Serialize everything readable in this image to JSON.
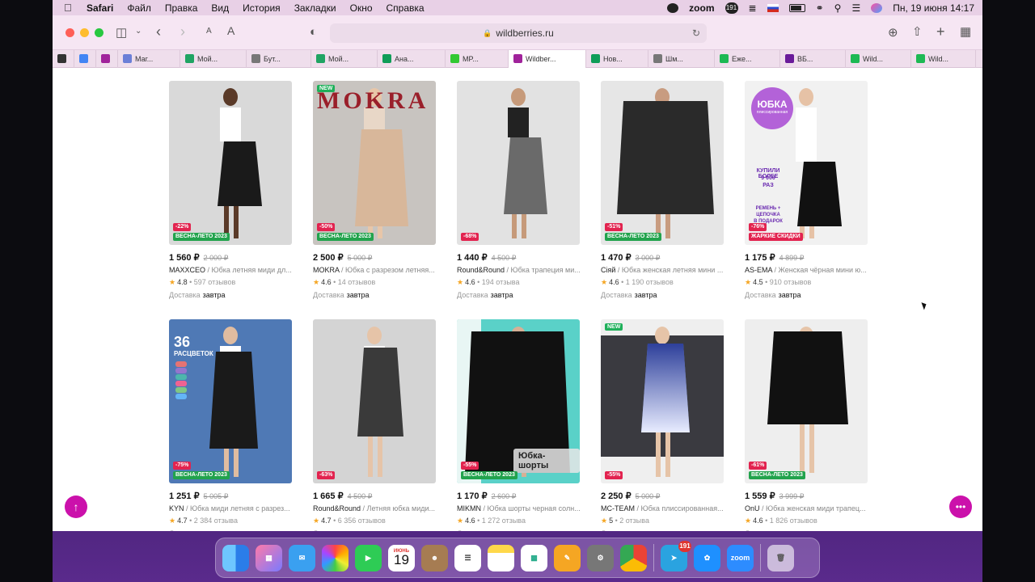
{
  "menubar": {
    "app": "Safari",
    "items": [
      "Файл",
      "Правка",
      "Вид",
      "История",
      "Закладки",
      "Окно",
      "Справка"
    ],
    "zoom": "zoom",
    "badge": "191",
    "datetime": "Пн, 19 июня  14:17"
  },
  "browser": {
    "url": "wildberries.ru",
    "tabs": [
      {
        "label": "",
        "icon": "extension-icon",
        "color": "#333333"
      },
      {
        "label": "",
        "icon": "calendar-icon",
        "color": "#4285f4"
      },
      {
        "label": "",
        "icon": "wb-icon",
        "color": "#a0239b"
      },
      {
        "label": "Маг...",
        "icon": "chart-icon",
        "color": "#6b7fd7"
      },
      {
        "label": "Мой...",
        "icon": "drive-icon",
        "color": "#1fa463"
      },
      {
        "label": "Бут...",
        "icon": "doc-icon",
        "color": "#777777"
      },
      {
        "label": "Мой...",
        "icon": "drive-icon",
        "color": "#1fa463"
      },
      {
        "label": "Ана...",
        "icon": "sheets-icon",
        "color": "#0f9d58"
      },
      {
        "label": "MP...",
        "icon": "mp-icon",
        "color": "#32c832"
      },
      {
        "label": "Wildber...",
        "icon": "wb-icon",
        "color": "#a0239b"
      },
      {
        "label": "Нов...",
        "icon": "sheets-icon",
        "color": "#0f9d58"
      },
      {
        "label": "Шм...",
        "icon": "doc-icon",
        "color": "#777777"
      },
      {
        "label": "Еже...",
        "icon": "v-icon",
        "color": "#1db954"
      },
      {
        "label": "ВБ...",
        "icon": "wb-icon",
        "color": "#6a1b9a"
      },
      {
        "label": "Wild...",
        "icon": "v-icon",
        "color": "#1db954"
      },
      {
        "label": "Wild...",
        "icon": "v-icon",
        "color": "#1db954"
      }
    ]
  },
  "labels": {
    "promo_summer": "ВЕСНА-ЛЕТО 2023",
    "promo_hot": "ЖАРКИЕ СКИДКИ",
    "new": "NEW",
    "delivery": "Доставка",
    "delivery_when": "завтра",
    "star": "★"
  },
  "products": [
    {
      "price": "1 560 ₽",
      "old": "2 000 ₽",
      "brand": "MAXXCEO",
      "title": " / Юбка летняя миди дл...",
      "rating": "4.8",
      "reviews": " • 597 отзывов",
      "discount": "-22%",
      "promo": "ВЕСНА-ЛЕТО 2023",
      "isnew": false,
      "overlay": ""
    },
    {
      "price": "2 500 ₽",
      "old": "5 000 ₽",
      "brand": "MOKRA",
      "title": " / Юбка с разрезом летняя...",
      "rating": "4.6",
      "reviews": " • 14 отзывов",
      "discount": "-50%",
      "promo": "ВЕСНА-ЛЕТО 2023",
      "isnew": true,
      "overlay": "MOKRA"
    },
    {
      "price": "1 440 ₽",
      "old": "4 500 ₽",
      "brand": "Round&Round",
      "title": " / Юбка трапеция ми...",
      "rating": "4.6",
      "reviews": " • 194 отзыва",
      "discount": "-68%",
      "promo": "",
      "isnew": false,
      "overlay": ""
    },
    {
      "price": "1 470 ₽",
      "old": "3 000 ₽",
      "brand": "Сіяй",
      "title": " / Юбка женская летняя мини ...",
      "rating": "4.6",
      "reviews": " • 1 190 отзывов",
      "discount": "-51%",
      "promo": "ВЕСНА-ЛЕТО 2023",
      "isnew": false,
      "overlay": ""
    },
    {
      "price": "1 175 ₽",
      "old": "4 899 ₽",
      "brand": "AS-EMA",
      "title": " / Женская чёрная мини ю...",
      "rating": "4.5",
      "reviews": " • 910 отзывов",
      "discount": "-76%",
      "promo": "ЖАРКИЕ СКИДКИ",
      "isnew": false,
      "overlay": "ЮБКА"
    },
    {
      "price": "1 251 ₽",
      "old": "5 005 ₽",
      "brand": "KYN",
      "title": " / Юбка миди летняя с разрез...",
      "rating": "4.7",
      "reviews": " • 2 384 отзыва",
      "discount": "-75%",
      "promo": "ВЕСНА-ЛЕТО 2023",
      "isnew": false,
      "overlay": "36"
    },
    {
      "price": "1 665 ₽",
      "old": "4 500 ₽",
      "brand": "Round&Round",
      "title": " / Летняя юбка миди...",
      "rating": "4.7",
      "reviews": " • 6 356 отзывов",
      "discount": "-63%",
      "promo": "",
      "isnew": false,
      "overlay": ""
    },
    {
      "price": "1 170 ₽",
      "old": "2 600 ₽",
      "brand": "MIKMN",
      "title": " / Юбка шорты черная солн...",
      "rating": "4.6",
      "reviews": " • 1 272 отзыва",
      "discount": "-55%",
      "promo": "ВЕСНА-ЛЕТО 2023",
      "isnew": false,
      "overlay": "Юбка-шорты"
    },
    {
      "price": "2 250 ₽",
      "old": "5 000 ₽",
      "brand": "MC-TEAM",
      "title": " / Юбка плиссированная...",
      "rating": "5",
      "reviews": " • 2 отзыва",
      "discount": "-55%",
      "promo": "",
      "isnew": true,
      "overlay": ""
    },
    {
      "price": "1 559 ₽",
      "old": "3 999 ₽",
      "brand": "OnU",
      "title": " / Юбка женская миди трапец...",
      "rating": "4.6",
      "reviews": " • 1 826 отзывов",
      "discount": "-61%",
      "promo": "ВЕСНА-ЛЕТО 2023",
      "isnew": false,
      "overlay": ""
    }
  ],
  "image_overlays": {
    "p4_circle": "ЮБКА",
    "p4_sub": "плиссированная",
    "p4_bought": "КУПИЛИ БОЛЕЕ",
    "p4_count": "9 000",
    "p4_times": "РАЗ",
    "p4_belt": "РЕМЕНЬ +",
    "p4_chain": "ЦЕПОЧКА",
    "p4_gift": "В ПОДАРОК",
    "p5_count": "36",
    "p5_colors": "РАСЦВЕТОК"
  },
  "dock": {
    "calendar_month": "ИЮНЬ",
    "calendar_day": "19",
    "telegram_badge": "191",
    "zoom_label": "zoom"
  },
  "colors": {
    "brand": "#cb11ab",
    "discount": "#e2234f",
    "promo_summer": "#22a34d",
    "promo_hot": "#e2234f"
  }
}
